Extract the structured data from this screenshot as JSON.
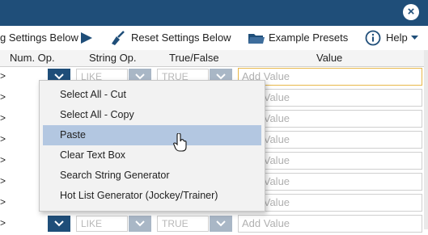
{
  "toolbar": {
    "save_label": "g Settings Below",
    "reset_label": "Reset Settings Below",
    "presets_label": "Example Presets",
    "help_label": "Help"
  },
  "columns": [
    "Num. Op.",
    "String Op.",
    "True/False",
    "Value"
  ],
  "rows": [
    {
      "op": ">",
      "num_op": "",
      "string_op": "LIKE",
      "true_false": "TRUE",
      "value_placeholder": "Add Value",
      "focused": true
    },
    {
      "op": ">",
      "num_op": "",
      "string_op": "",
      "true_false": "",
      "value_placeholder": "Add Value",
      "focused": false
    },
    {
      "op": ">",
      "num_op": "",
      "string_op": "",
      "true_false": "",
      "value_placeholder": "Add Value",
      "focused": false
    },
    {
      "op": ">",
      "num_op": "",
      "string_op": "",
      "true_false": "",
      "value_placeholder": "Add Value",
      "focused": false
    },
    {
      "op": ">",
      "num_op": "",
      "string_op": "",
      "true_false": "",
      "value_placeholder": "Add Value",
      "focused": false
    },
    {
      "op": ">",
      "num_op": "",
      "string_op": "",
      "true_false": "",
      "value_placeholder": "Add Value",
      "focused": false
    },
    {
      "op": ">",
      "num_op": "",
      "string_op": "",
      "true_false": "",
      "value_placeholder": "Add Value",
      "focused": false
    },
    {
      "op": ">",
      "num_op": "",
      "string_op": "LIKE",
      "true_false": "TRUE",
      "value_placeholder": "Add Value",
      "focused": false
    }
  ],
  "context_menu": {
    "items": [
      "Select All - Cut",
      "Select All - Copy",
      "Paste",
      "Clear Text Box",
      "Search String Generator",
      "Hot List Generator (Jockey/Trainer)"
    ],
    "highlighted": "Paste"
  },
  "colors": {
    "titlebar": "#1f4e79",
    "dropdown_button": "#1f4e79",
    "menu_highlight": "#b3c7e1",
    "focus_border": "#e8b84a"
  },
  "icons": {
    "close": "close-icon",
    "save": "play-arrow-icon",
    "reset": "broom-icon",
    "presets": "folder-icon",
    "help": "info-circle-icon"
  }
}
